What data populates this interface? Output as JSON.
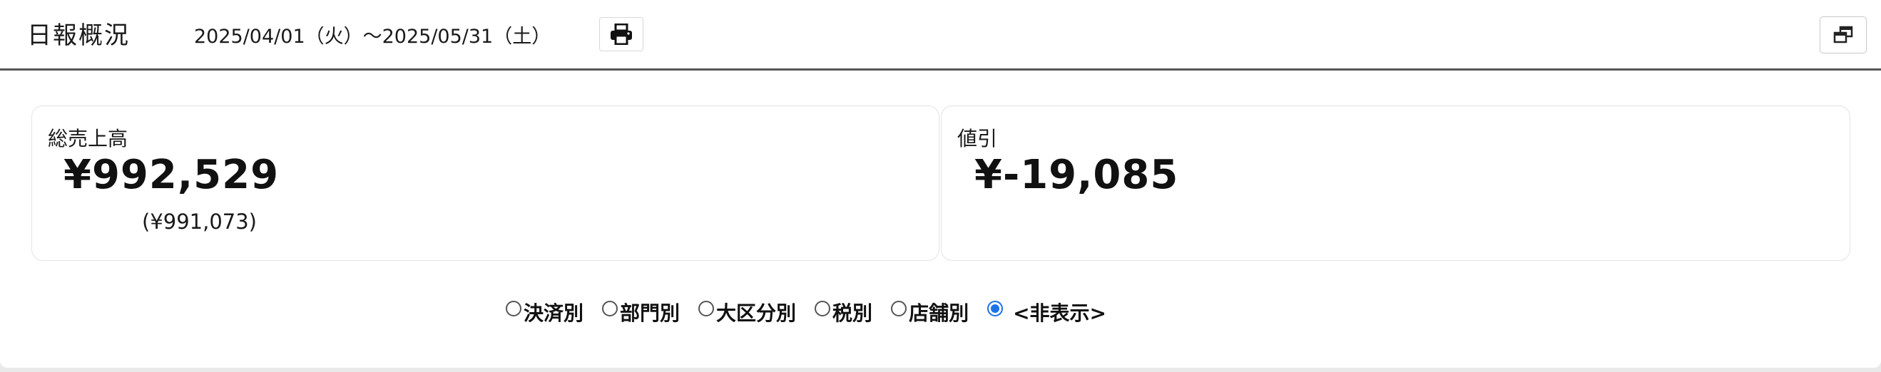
{
  "header": {
    "title": "日報概況",
    "period": "2025/04/01（火）～2025/05/31（土）",
    "print_icon": "printer-icon",
    "window_icon": "restore-window-icon"
  },
  "cards": {
    "sales": {
      "label": "総売上高",
      "value": "¥992,529",
      "sub": "(¥991,073)"
    },
    "discount": {
      "label": "値引",
      "value": "¥-19,085"
    }
  },
  "breakdown": {
    "options": [
      {
        "label": "決済別",
        "checked": false
      },
      {
        "label": "部門別",
        "checked": false
      },
      {
        "label": "大区分別",
        "checked": false
      },
      {
        "label": "税別",
        "checked": false
      },
      {
        "label": "店舗別",
        "checked": false
      },
      {
        "label": "<非表示>",
        "checked": true
      }
    ]
  },
  "colors": {
    "accent": "#1a73e8",
    "header_rule": "#555555",
    "card_border": "#e3e3e3"
  }
}
